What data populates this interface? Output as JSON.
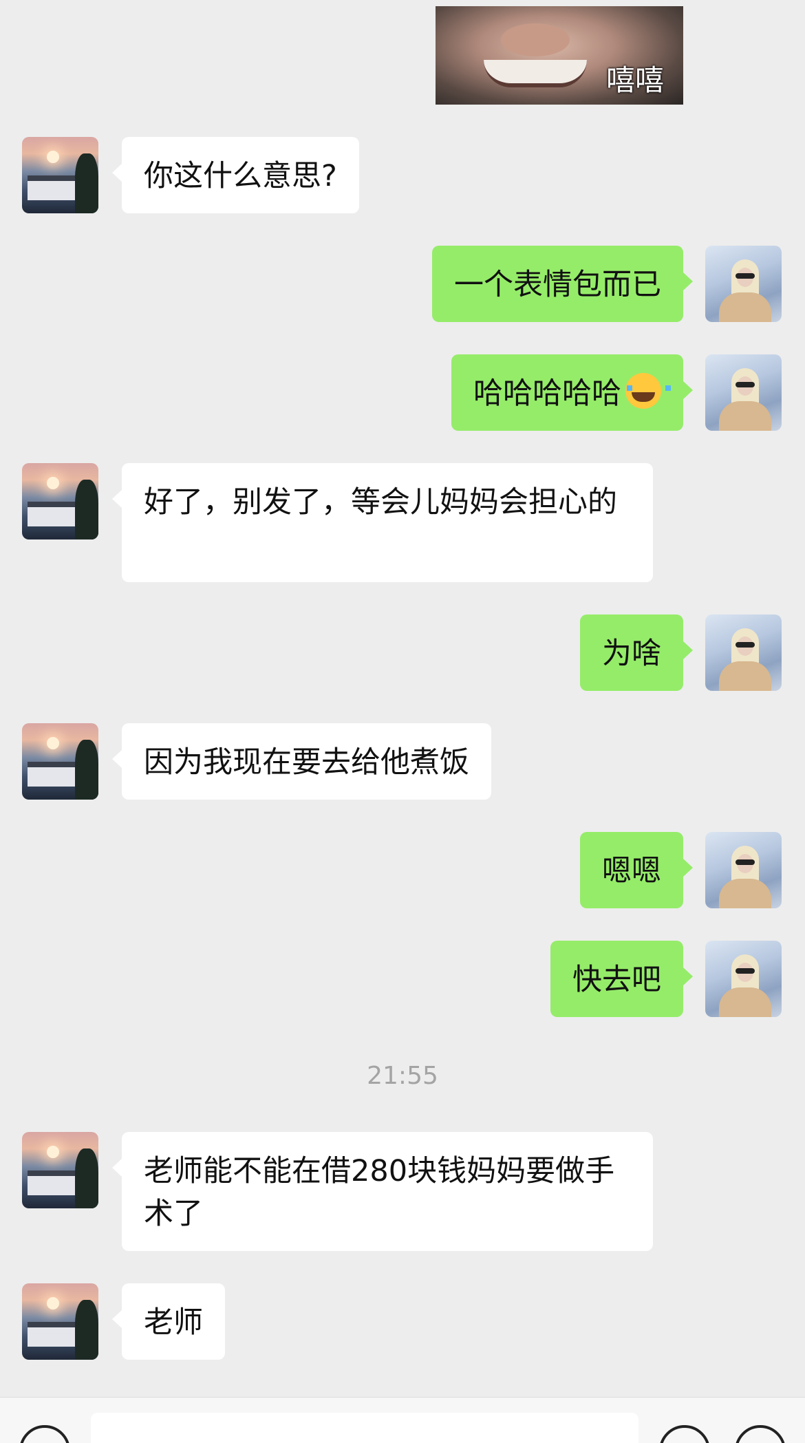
{
  "sticker": {
    "caption": "嘻嘻"
  },
  "messages": [
    {
      "side": "in",
      "text": "你这什么意思?"
    },
    {
      "side": "out",
      "text": "一个表情包而已"
    },
    {
      "side": "out",
      "text": "哈哈哈哈哈",
      "emoji": "face-with-tears-of-joy"
    },
    {
      "side": "in",
      "text": "好了，别发了，等会儿妈妈会担心的"
    },
    {
      "side": "out",
      "text": "为啥"
    },
    {
      "side": "in",
      "text": "因为我现在要去给他煮饭"
    },
    {
      "side": "out",
      "text": "嗯嗯"
    },
    {
      "side": "out",
      "text": "快去吧"
    },
    {
      "side": "in",
      "text": "老师能不能在借280块钱妈妈要做手术了"
    },
    {
      "side": "in",
      "text": "老师"
    }
  ],
  "timestamp": "21:55",
  "colors": {
    "background": "#ededed",
    "bubble_in": "#ffffff",
    "bubble_out": "#95ec69",
    "timestamp": "#a4a4a4"
  },
  "icons": {
    "voice": "voice-icon",
    "emoji": "emoji-icon",
    "more": "plus-icon"
  }
}
